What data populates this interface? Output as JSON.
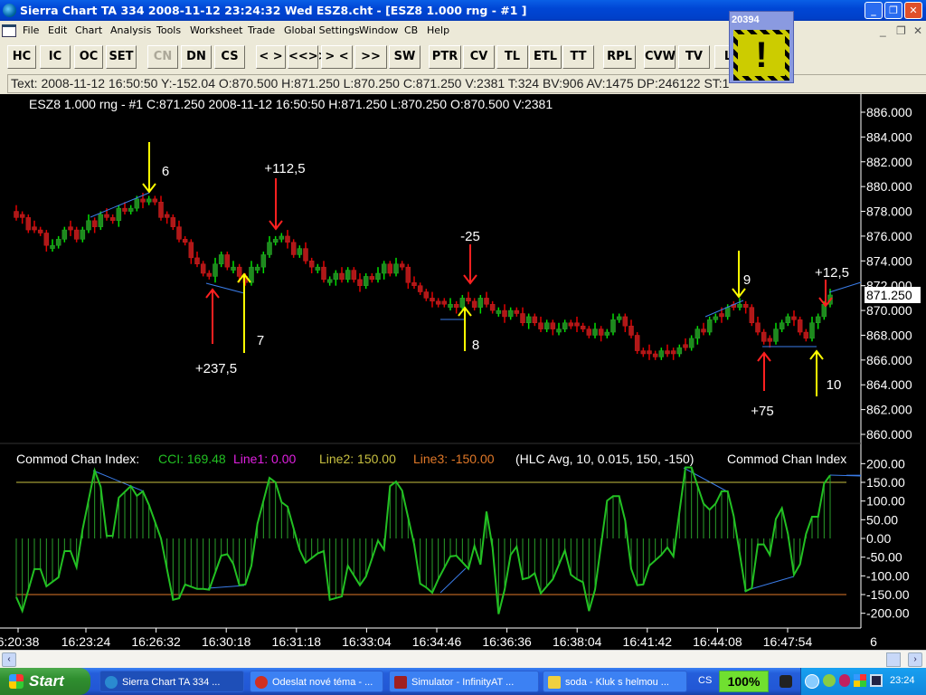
{
  "window": {
    "title": "Sierra Chart TA 334  2008-11-12  23:24:32  Wed   ESZ8.cht - [ESZ8  1.000 rng - #1 ]",
    "minimize": "_",
    "restore": "❐",
    "close": "✕"
  },
  "menu": [
    "File",
    "Edit",
    "Chart",
    "Analysis",
    "Tools",
    "Worksheet",
    "Trade",
    "Global Settings",
    "Window",
    "CB",
    "Help"
  ],
  "mdi": {
    "minimize": "_",
    "restore": "❐",
    "close": "✕"
  },
  "toolbar": [
    {
      "label": "HC"
    },
    {
      "label": "IC"
    },
    {
      "label": "OC"
    },
    {
      "label": "SET"
    },
    {
      "label": "CN",
      "disabled": true
    },
    {
      "label": "DN"
    },
    {
      "label": "CS"
    },
    {
      "label": "< >"
    },
    {
      "label": "<<>>"
    },
    {
      "label": "> <"
    },
    {
      "label": ">><<"
    },
    {
      "label": "SW"
    },
    {
      "label": "PTR"
    },
    {
      "label": "CV"
    },
    {
      "label": "TL"
    },
    {
      "label": "ETL"
    },
    {
      "label": "TT"
    },
    {
      "label": "RPL"
    },
    {
      "label": "CVW"
    },
    {
      "label": "TV"
    },
    {
      "label": "L"
    }
  ],
  "infoline": "Text: 2008-11-12  16:50:50  Y:-152.04  O:870.500  H:871.250  L:870.250  C:871.250  V:2381  T:324  BV:906  AV:1475  DP:246122  ST:1",
  "alert_popup": {
    "title": "20394",
    "icon": "warning-exclamation-icon",
    "colors": {
      "bg": "#cccc00",
      "stripe": "#000000"
    }
  },
  "chart_data": [
    {
      "type": "candlestick",
      "symbol_header": "ESZ8  1.000 rng - #1  C:871.250  2008-11-12  16:50:50  H:871.250  L:870.250  O:870.500  V:2381",
      "ylim": [
        860,
        886
      ],
      "y_ticks": [
        "886.000",
        "884.000",
        "882.000",
        "880.000",
        "878.000",
        "876.000",
        "874.000",
        "872.000",
        "870.000",
        "868.000",
        "866.000",
        "864.000",
        "862.000",
        "860.000"
      ],
      "last_price_label": "871.250",
      "x_ticks": [
        "6:20:38",
        "16:23:24",
        "16:26:32",
        "16:30:18",
        "16:31:18",
        "16:33:04",
        "16:34:46",
        "16:36:36",
        "16:38:04",
        "16:41:42",
        "16:44:08",
        "16:47:54",
        "6"
      ],
      "bar_count": 136,
      "close_path": [
        [
          0,
          877.5
        ],
        [
          3,
          876.5
        ],
        [
          6,
          875.3
        ],
        [
          8,
          876.5
        ],
        [
          10,
          875.8
        ],
        [
          12,
          877.2
        ],
        [
          15,
          877.5
        ],
        [
          18,
          878
        ],
        [
          21,
          878.8
        ],
        [
          22,
          879
        ],
        [
          25,
          877.5
        ],
        [
          28,
          875.5
        ],
        [
          31,
          873
        ],
        [
          32,
          872.8
        ],
        [
          34,
          874.5
        ],
        [
          36,
          873.5
        ],
        [
          38,
          872.2
        ],
        [
          41,
          874.5
        ],
        [
          43,
          875.8
        ],
        [
          45,
          875.5
        ],
        [
          48,
          874
        ],
        [
          50,
          873.5
        ],
        [
          52,
          872.5
        ],
        [
          55,
          873.2
        ],
        [
          57,
          872
        ],
        [
          60,
          873
        ],
        [
          63,
          873.8
        ],
        [
          66,
          872
        ],
        [
          69,
          870.8
        ],
        [
          72,
          870.5
        ],
        [
          75,
          870.8
        ],
        [
          78,
          870.5
        ],
        [
          80,
          870
        ],
        [
          83,
          869.8
        ],
        [
          86,
          869
        ],
        [
          89,
          868.5
        ],
        [
          92,
          868.8
        ],
        [
          95,
          868
        ],
        [
          98,
          868.2
        ],
        [
          100,
          869.5
        ],
        [
          102,
          868
        ],
        [
          104,
          866.5
        ],
        [
          106,
          866.2
        ],
        [
          108,
          866.5
        ],
        [
          110,
          867
        ],
        [
          112,
          867.8
        ],
        [
          115,
          869.2
        ],
        [
          117,
          869.5
        ],
        [
          119,
          870.2
        ],
        [
          120,
          870.5
        ],
        [
          122,
          869
        ],
        [
          124,
          867.5
        ],
        [
          126,
          868.5
        ],
        [
          128,
          869.5
        ],
        [
          130,
          868.2
        ],
        [
          131,
          867.8
        ],
        [
          133,
          869.5
        ],
        [
          135,
          871.25
        ]
      ],
      "colors": {
        "up": "#1e8a1e",
        "down": "#b01818",
        "up_wick": "#00e000",
        "down_wick": "#e00000",
        "trendline": "#3a7ce8"
      },
      "annotations": [
        {
          "label": "6",
          "arrow": "down",
          "color": "#ffff00"
        },
        {
          "label": "+112,5",
          "arrow": "down",
          "color": "#ff2020"
        },
        {
          "label": "+237,5",
          "arrow": "up",
          "color": "#ff2020"
        },
        {
          "label": "7",
          "arrow": "up",
          "color": "#ffff00"
        },
        {
          "label": "-25",
          "arrow": "down",
          "color": "#ff2020"
        },
        {
          "label": "8",
          "arrow": "up",
          "color": "#ffff00"
        },
        {
          "label": "9",
          "arrow": "down",
          "color": "#ffff00"
        },
        {
          "label": "+75",
          "arrow": "up",
          "color": "#ff2020"
        },
        {
          "label": "10",
          "arrow": "up",
          "color": "#ffff00"
        },
        {
          "label": "+12,5",
          "arrow": "down",
          "color": "#ff2020"
        }
      ]
    },
    {
      "type": "line",
      "study": "Commod Chan Index",
      "ylim": [
        -200,
        200
      ],
      "legend": {
        "name": "Commod Chan Index:",
        "cci": "CCI: 169.48",
        "line1": "Line1: 0.00",
        "line2": "Line2: 150.00",
        "line3": "Line3: -150.00",
        "params": "(HLC Avg, 10, 0.015, 150, -150)",
        "name2": "Commod Chan Index"
      },
      "y_ticks": [
        "200.00",
        "150.00",
        "100.00",
        "50.00",
        "0.00",
        "-50.00",
        "-100.00",
        "-150.00",
        "-200.00"
      ],
      "levels": {
        "line1": 0,
        "line2": 150,
        "line3": -150
      },
      "colors": {
        "cci": "#22c022",
        "line1": "#e020e0",
        "line2": "#c8c040",
        "line3": "#e07828",
        "legend_name": "#ffffff"
      },
      "cci_series": [
        [
          0,
          -157
        ],
        [
          1,
          -194
        ],
        [
          3,
          -82
        ],
        [
          4,
          -82
        ],
        [
          5,
          -128
        ],
        [
          7,
          -104
        ],
        [
          8,
          -34
        ],
        [
          9,
          -34
        ],
        [
          10,
          -77
        ],
        [
          11,
          24
        ],
        [
          13,
          182
        ],
        [
          14,
          138
        ],
        [
          15,
          7
        ],
        [
          16,
          7
        ],
        [
          17,
          109
        ],
        [
          19,
          140
        ],
        [
          20,
          114
        ],
        [
          21,
          126
        ],
        [
          22,
          90
        ],
        [
          24,
          0
        ],
        [
          26,
          -164
        ],
        [
          27,
          -160
        ],
        [
          28,
          -123
        ],
        [
          30,
          -135
        ],
        [
          31,
          -135
        ],
        [
          32,
          -137
        ],
        [
          34,
          -46
        ],
        [
          35,
          -42
        ],
        [
          36,
          -68
        ],
        [
          37,
          -125
        ],
        [
          38,
          -123
        ],
        [
          39,
          -73
        ],
        [
          40,
          39
        ],
        [
          42,
          162
        ],
        [
          43,
          150
        ],
        [
          44,
          97
        ],
        [
          45,
          85
        ],
        [
          47,
          -31
        ],
        [
          48,
          -65
        ],
        [
          50,
          -40
        ],
        [
          51,
          -34
        ],
        [
          52,
          -164
        ],
        [
          54,
          -155
        ],
        [
          55,
          -73
        ],
        [
          57,
          -125
        ],
        [
          58,
          -102
        ],
        [
          60,
          -6
        ],
        [
          61,
          -30
        ],
        [
          62,
          140
        ],
        [
          63,
          152
        ],
        [
          64,
          128
        ],
        [
          66,
          -16
        ],
        [
          67,
          -121
        ],
        [
          68,
          -131
        ],
        [
          69,
          -145
        ],
        [
          70,
          -109
        ],
        [
          72,
          -48
        ],
        [
          73,
          -46
        ],
        [
          75,
          -81
        ],
        [
          76,
          -20
        ],
        [
          77,
          -70
        ],
        [
          78,
          72
        ],
        [
          79,
          -24
        ],
        [
          80,
          -202
        ],
        [
          81,
          -137
        ],
        [
          82,
          -44
        ],
        [
          83,
          -22
        ],
        [
          84,
          -109
        ],
        [
          85,
          -105
        ],
        [
          86,
          -93
        ],
        [
          87,
          -147
        ],
        [
          89,
          -109
        ],
        [
          91,
          -32
        ],
        [
          92,
          -97
        ],
        [
          93,
          -109
        ],
        [
          94,
          -117
        ],
        [
          95,
          -194
        ],
        [
          96,
          -137
        ],
        [
          98,
          101
        ],
        [
          99,
          113
        ],
        [
          100,
          113
        ],
        [
          101,
          48
        ],
        [
          102,
          -81
        ],
        [
          103,
          -125
        ],
        [
          104,
          -123
        ],
        [
          105,
          -73
        ],
        [
          107,
          -44
        ],
        [
          108,
          -24
        ],
        [
          109,
          -48
        ],
        [
          111,
          190
        ],
        [
          112,
          190
        ],
        [
          113,
          141
        ],
        [
          114,
          93
        ],
        [
          115,
          77
        ],
        [
          116,
          93
        ],
        [
          117,
          126
        ],
        [
          118,
          126
        ],
        [
          119,
          60
        ],
        [
          121,
          -141
        ],
        [
          122,
          -133
        ],
        [
          123,
          -16
        ],
        [
          124,
          -16
        ],
        [
          125,
          -44
        ],
        [
          126,
          52
        ],
        [
          127,
          81
        ],
        [
          128,
          12
        ],
        [
          129,
          -97
        ],
        [
          130,
          -69
        ],
        [
          131,
          12
        ],
        [
          132,
          58
        ],
        [
          133,
          58
        ],
        [
          134,
          147
        ],
        [
          135,
          169
        ]
      ]
    }
  ],
  "scrollbar": {
    "left": "‹",
    "right": "›"
  },
  "taskbar": {
    "start": "Start",
    "tasks": [
      "Sierra Chart TA 334  ...",
      "Odeslat nové téma - ...",
      "Simulator - InfinityAT ...",
      "soda - Kluk s helmou ..."
    ],
    "lang": "CS",
    "battery": "100%",
    "clock": "23:24"
  }
}
